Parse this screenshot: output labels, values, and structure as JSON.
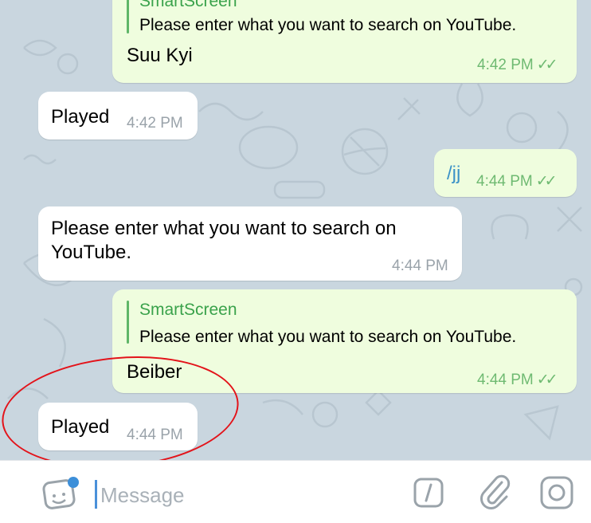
{
  "messages": [
    {
      "reply_name": "SmartScreen",
      "reply_text": "Please enter what you want to search on YouTube.",
      "text": "Suu Kyi",
      "time": "4:42 PM",
      "ticks": "✓✓"
    },
    {
      "text": "Played",
      "time": "4:42 PM"
    },
    {
      "text": "/jj",
      "time": "4:44 PM",
      "ticks": "✓✓"
    },
    {
      "text_line1": "Please enter what you want to search on",
      "text_line2": "YouTube.",
      "time": "4:44 PM"
    },
    {
      "reply_name": "SmartScreen",
      "reply_text": "Please enter what you want to search on YouTube.",
      "text": "Beiber",
      "time": "4:44 PM",
      "ticks": "✓✓"
    },
    {
      "text": "Played",
      "time": "4:44 PM"
    }
  ],
  "input": {
    "placeholder": "Message",
    "icons": [
      "sticker-icon",
      "slash-command-icon",
      "attach-icon",
      "camera-icon"
    ]
  },
  "colors": {
    "outgoing": "#effdde",
    "incoming": "#ffffff",
    "chat_bg": "#c9d6df",
    "accent_green": "#3aa24b",
    "annotation": "#e3131a"
  }
}
